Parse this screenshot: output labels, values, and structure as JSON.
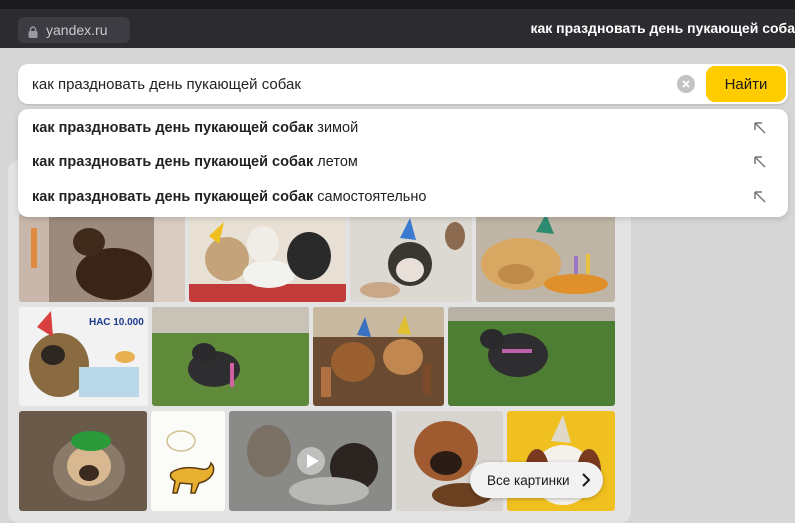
{
  "browser": {
    "url_domain": "yandex.ru",
    "page_title": "как праздновать день пукающей соба"
  },
  "search": {
    "query": "как праздновать день пукающей собак",
    "submit_label": "Найти"
  },
  "suggestions": [
    {
      "bold": "как праздновать день пукающей собак",
      "rest": "зимой"
    },
    {
      "bold": "как праздновать день пукающей собак",
      "rest": "летом"
    },
    {
      "bold": "как праздновать день пукающей собак",
      "rest": "самостоятельно"
    }
  ],
  "images": {
    "tile_text": {
      "nas_10000": "НАС 10.000"
    },
    "all_images_label": "Все картинки"
  },
  "icons": {
    "lock": "lock-icon",
    "clear": "close-icon",
    "suggest_arrow": "arrow-up-left-icon",
    "chevron": "chevron-right-icon",
    "play": "play-icon"
  },
  "colors": {
    "find_button": "#ffcc00",
    "topbar": "#2c2c30"
  }
}
